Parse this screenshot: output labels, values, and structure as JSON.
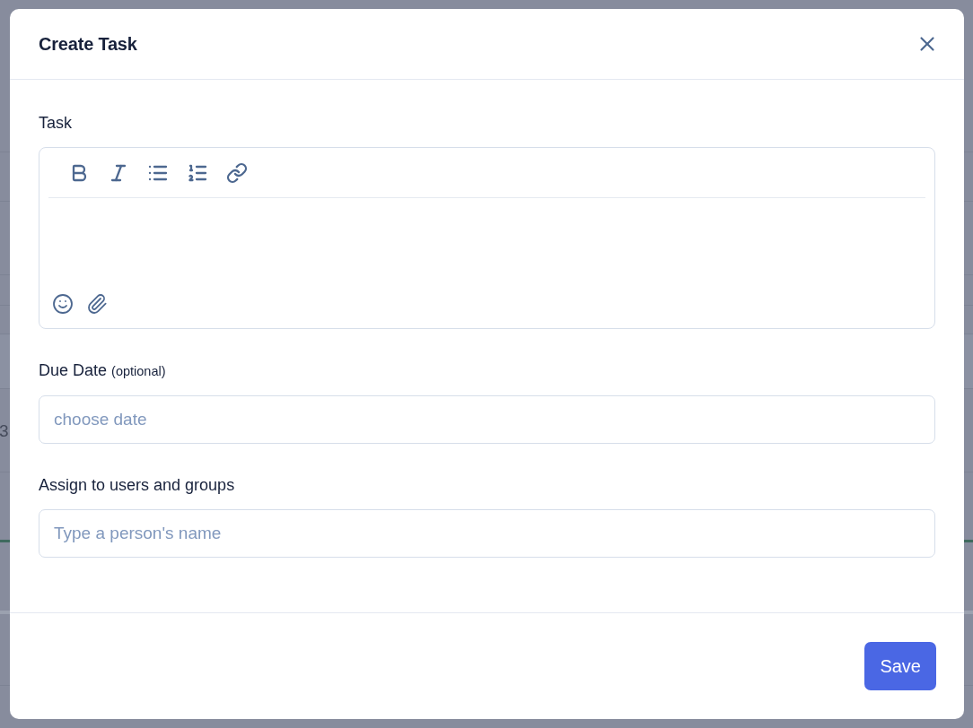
{
  "backdrop": {
    "text_fragment": "3"
  },
  "dialog": {
    "title": "Create Task",
    "task": {
      "label": "Task"
    },
    "fields": [
      {
        "label": "Due Date",
        "note": "(optional)",
        "placeholder": "choose date"
      },
      {
        "label": "Assign to users and groups",
        "placeholder": "Type a person's name"
      }
    ],
    "buttons": [
      {
        "label": "Save",
        "kind": "primary"
      }
    ]
  }
}
